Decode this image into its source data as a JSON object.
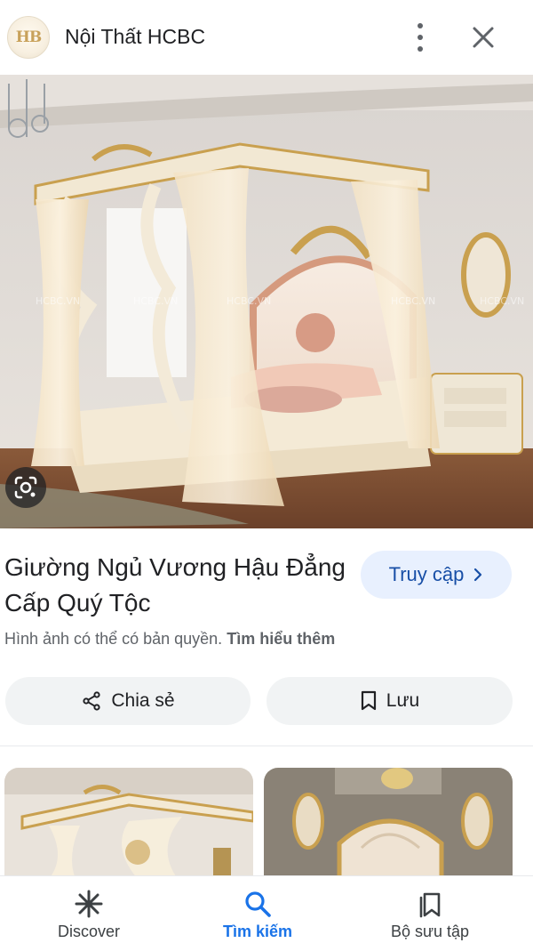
{
  "header": {
    "logo_text": "HB",
    "site_name": "Nội Thất HCBC"
  },
  "hero": {
    "watermarks": [
      "HCBC.VN",
      "HCBC.VN",
      "HCBC.VN",
      "HCBC.VN",
      "HCBC.VN"
    ]
  },
  "result": {
    "title": "Giường Ngủ Vương Hậu Đẳng Cấp Quý Tộc",
    "visit_label": "Truy cập",
    "copyright_text": "Hình ảnh có thể có bản quyền.",
    "learn_more": "Tìm hiểu thêm",
    "share_label": "Chia sẻ",
    "save_label": "Lưu"
  },
  "bottom_nav": {
    "items": [
      {
        "label": "Discover",
        "icon": "asterisk-icon",
        "active": false
      },
      {
        "label": "Tìm kiếm",
        "icon": "search-icon",
        "active": true
      },
      {
        "label": "Bộ sưu tập",
        "icon": "collections-icon",
        "active": false
      }
    ]
  },
  "colors": {
    "accent": "#1a73e8",
    "visit_bg": "#e8f0fe",
    "chip_bg": "#f1f3f4"
  }
}
